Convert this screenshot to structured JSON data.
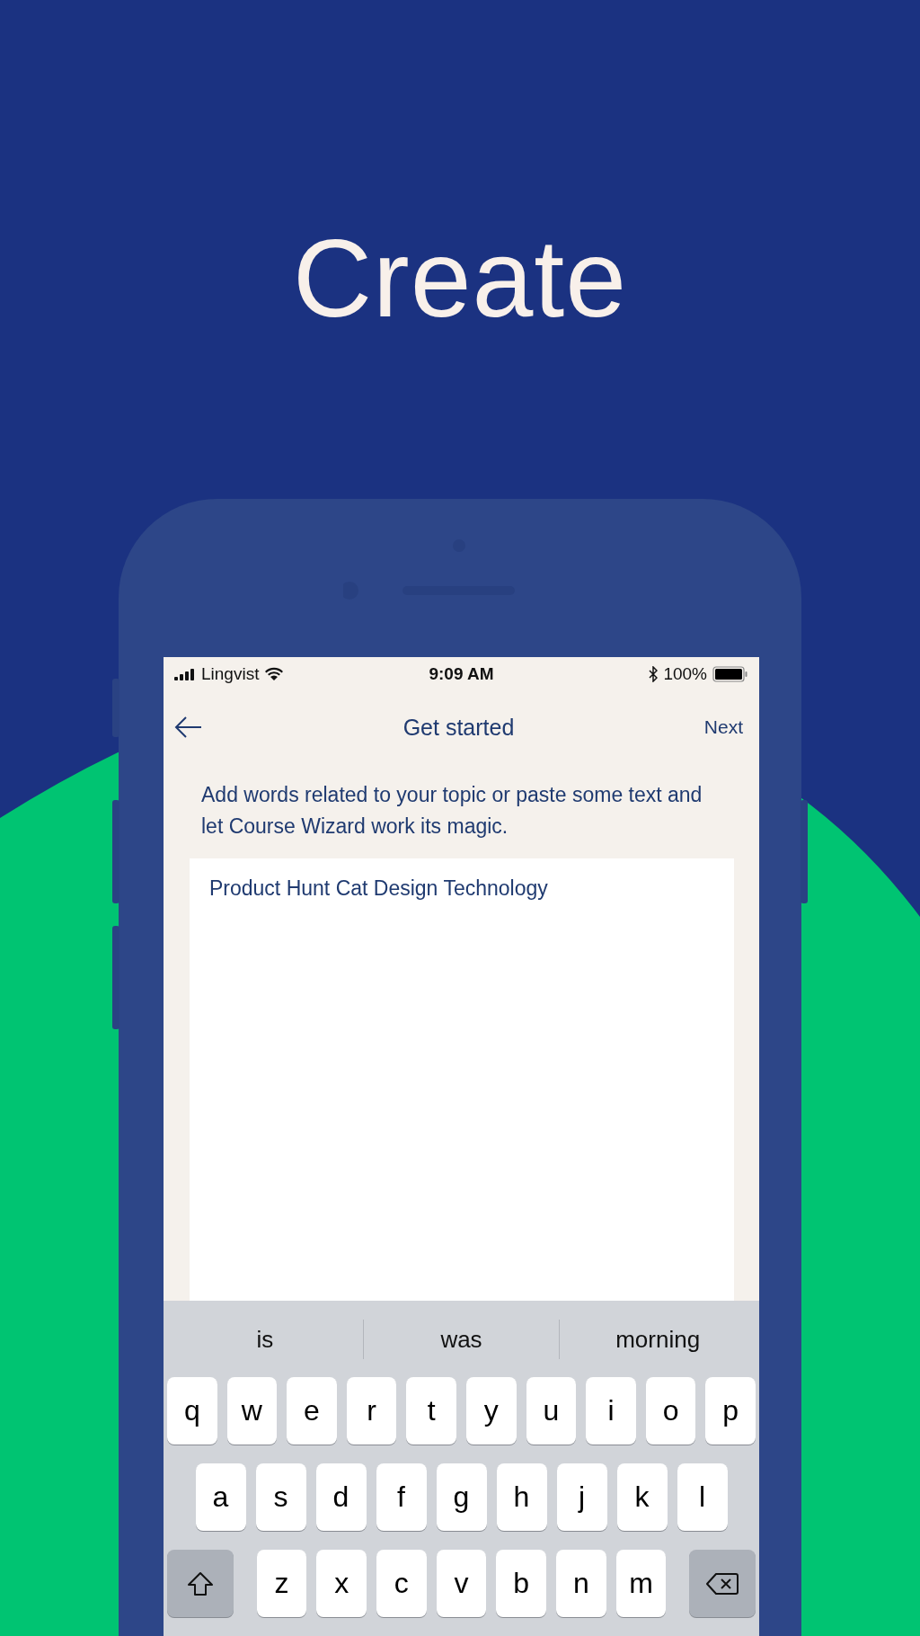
{
  "headline": "Create",
  "status_bar": {
    "carrier": "Lingvist",
    "time": "9:09 AM",
    "battery": "100%"
  },
  "nav": {
    "title": "Get started",
    "action": "Next"
  },
  "instructions": "Add words related to your topic or paste some text and let Course Wizard work its magic.",
  "text_area": {
    "value": "Product Hunt Cat Design Technology"
  },
  "keyboard": {
    "suggestions": [
      "is",
      "was",
      "morning"
    ],
    "rows": [
      [
        "q",
        "w",
        "e",
        "r",
        "t",
        "y",
        "u",
        "i",
        "o",
        "p"
      ],
      [
        "a",
        "s",
        "d",
        "f",
        "g",
        "h",
        "j",
        "k",
        "l"
      ],
      [
        "z",
        "x",
        "c",
        "v",
        "b",
        "n",
        "m"
      ]
    ]
  }
}
